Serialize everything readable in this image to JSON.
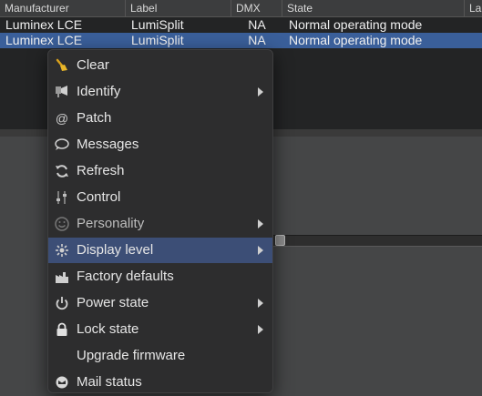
{
  "table": {
    "columns": [
      "Manufacturer",
      "Label",
      "DMX",
      "State",
      "Lamp"
    ],
    "rows": [
      {
        "manufacturer": "Luminex LCE",
        "label": "LumiSplit",
        "dmx": "NA",
        "state": "Normal operating mode"
      },
      {
        "manufacturer": "Luminex LCE",
        "label": "LumiSplit",
        "dmx": "NA",
        "state": "Normal operating mode"
      }
    ]
  },
  "context_menu": {
    "items": [
      {
        "label": "Clear",
        "icon": "broom-icon",
        "submenu": false
      },
      {
        "label": "Identify",
        "icon": "identify-icon",
        "submenu": true
      },
      {
        "label": "Patch",
        "icon": "at-icon",
        "submenu": false
      },
      {
        "label": "Messages",
        "icon": "speech-bubble-icon",
        "submenu": false
      },
      {
        "label": "Refresh",
        "icon": "refresh-icon",
        "submenu": false
      },
      {
        "label": "Control",
        "icon": "control-icon",
        "submenu": false
      },
      {
        "label": "Personality",
        "icon": "smiley-icon",
        "submenu": true
      },
      {
        "label": "Display level",
        "icon": "brightness-icon",
        "submenu": true
      },
      {
        "label": "Factory defaults",
        "icon": "factory-icon",
        "submenu": false
      },
      {
        "label": "Power state",
        "icon": "power-icon",
        "submenu": true
      },
      {
        "label": "Lock state",
        "icon": "lock-icon",
        "submenu": true
      },
      {
        "label": "Upgrade firmware",
        "icon": "",
        "submenu": false
      },
      {
        "label": "Mail status",
        "icon": "mail-status-icon",
        "submenu": false
      }
    ],
    "highlighted": "Display level",
    "highlight_color": "#3c4e76"
  },
  "selection_color": "#3a5f9a"
}
